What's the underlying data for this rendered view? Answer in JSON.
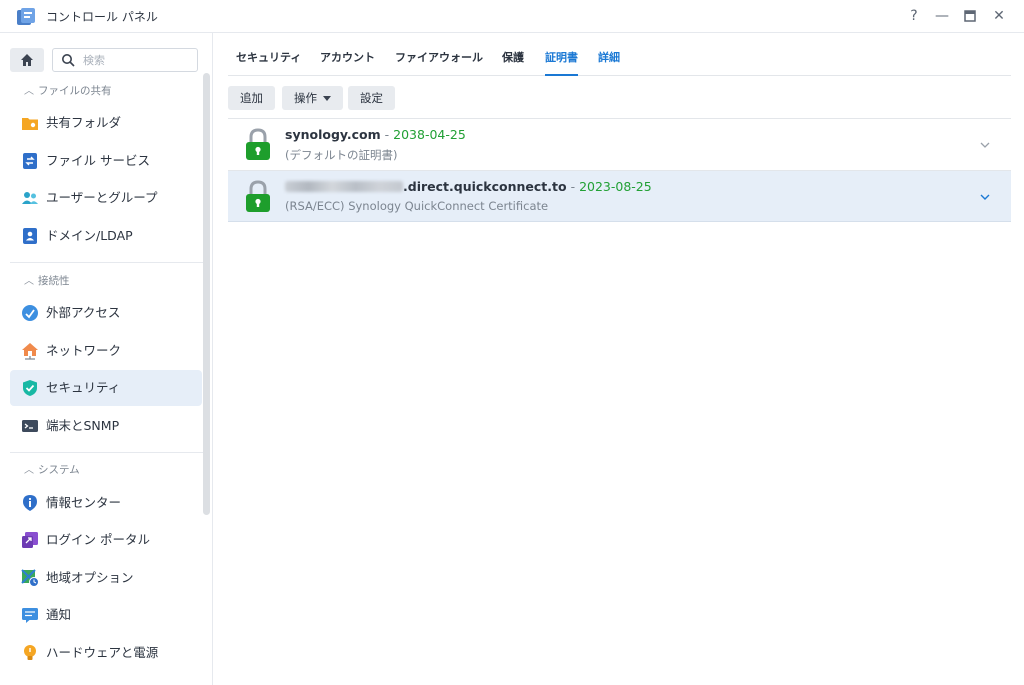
{
  "window": {
    "title": "コントロール パネル",
    "controls": {
      "help": "?",
      "minimize": "—",
      "maximize": "▭",
      "close": "✕"
    }
  },
  "sidebar": {
    "search_placeholder": "検索",
    "sections": [
      {
        "label": "ファイルの共有",
        "items": [
          {
            "label": "共有フォルダ",
            "icon": "shared-folder-icon"
          },
          {
            "label": "ファイル サービス",
            "icon": "file-services-icon"
          },
          {
            "label": "ユーザーとグループ",
            "icon": "users-groups-icon"
          },
          {
            "label": "ドメイン/LDAP",
            "icon": "domain-ldap-icon"
          }
        ]
      },
      {
        "label": "接続性",
        "items": [
          {
            "label": "外部アクセス",
            "icon": "external-access-icon"
          },
          {
            "label": "ネットワーク",
            "icon": "network-icon"
          },
          {
            "label": "セキュリティ",
            "icon": "security-shield-icon",
            "active": true
          },
          {
            "label": "端末とSNMP",
            "icon": "terminal-icon"
          }
        ]
      },
      {
        "label": "システム",
        "items": [
          {
            "label": "情報センター",
            "icon": "info-center-icon"
          },
          {
            "label": "ログイン ポータル",
            "icon": "login-portal-icon"
          },
          {
            "label": "地域オプション",
            "icon": "regional-options-icon"
          },
          {
            "label": "通知",
            "icon": "notification-icon"
          },
          {
            "label": "ハードウェアと電源",
            "icon": "hardware-power-icon"
          }
        ]
      }
    ]
  },
  "main": {
    "tabs": [
      {
        "label": "セキュリティ"
      },
      {
        "label": "アカウント"
      },
      {
        "label": "ファイアウォール"
      },
      {
        "label": "保護"
      },
      {
        "label": "証明書",
        "active": true
      },
      {
        "label": "詳細"
      }
    ],
    "toolbar": {
      "add": "追加",
      "action": "操作",
      "settings": "設定"
    },
    "certificates": [
      {
        "domain": "synology.com",
        "separator": " - ",
        "expiry": "2038-04-25",
        "description": "(デフォルトの証明書)",
        "selected": false
      },
      {
        "domain": ".direct.quickconnect.to",
        "separator": " - ",
        "expiry": "2023-08-25",
        "description": "(RSA/ECC) Synology QuickConnect Certificate",
        "selected": true
      }
    ]
  },
  "colors": {
    "accent": "#1a78d4",
    "date_green": "#22a035",
    "selected_bg": "#e6eef8",
    "lock_green": "#1e9e2c"
  }
}
